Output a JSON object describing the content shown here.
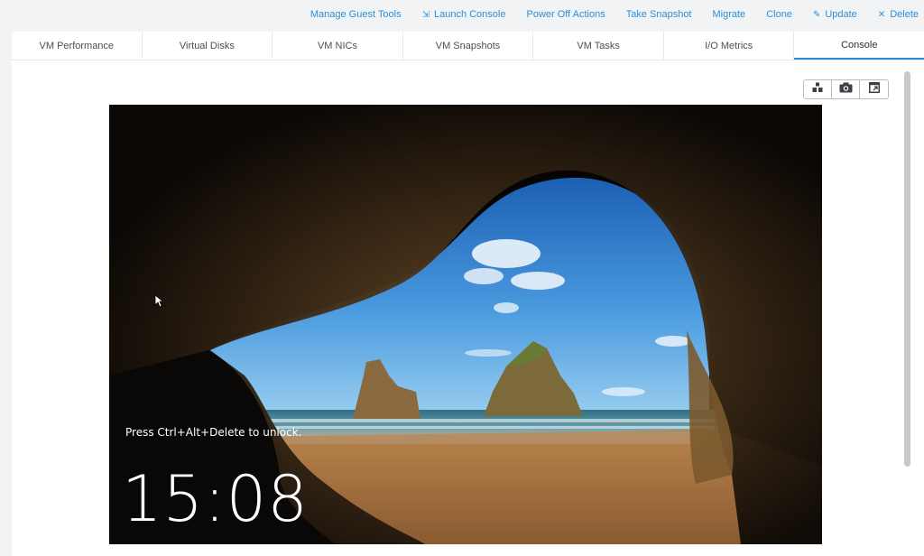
{
  "actions": [
    {
      "label": "Manage Guest Tools",
      "icon": ""
    },
    {
      "label": "Launch Console",
      "icon": "launch-console-icon"
    },
    {
      "label": "Power Off Actions",
      "icon": ""
    },
    {
      "label": "Take Snapshot",
      "icon": ""
    },
    {
      "label": "Migrate",
      "icon": ""
    },
    {
      "label": "Clone",
      "icon": ""
    },
    {
      "label": "Update",
      "icon": "pencil-icon"
    },
    {
      "label": "Delete",
      "icon": "x-icon"
    }
  ],
  "tabs": [
    {
      "label": "VM Performance"
    },
    {
      "label": "Virtual Disks"
    },
    {
      "label": "VM NICs"
    },
    {
      "label": "VM Snapshots"
    },
    {
      "label": "VM Tasks"
    },
    {
      "label": "I/O Metrics"
    },
    {
      "label": "Console",
      "active": true
    }
  ],
  "console_toolbar": [
    "send-keys-icon",
    "camera-icon",
    "popout-icon"
  ],
  "console": {
    "unlock_message": "Press Ctrl+Alt+Delete to unlock.",
    "clock": "15:08"
  },
  "colors": {
    "link": "#2b8fd6",
    "tab_active_border": "#2b8fd6",
    "sky": "#3d8fd4",
    "sand": "#b78249"
  }
}
